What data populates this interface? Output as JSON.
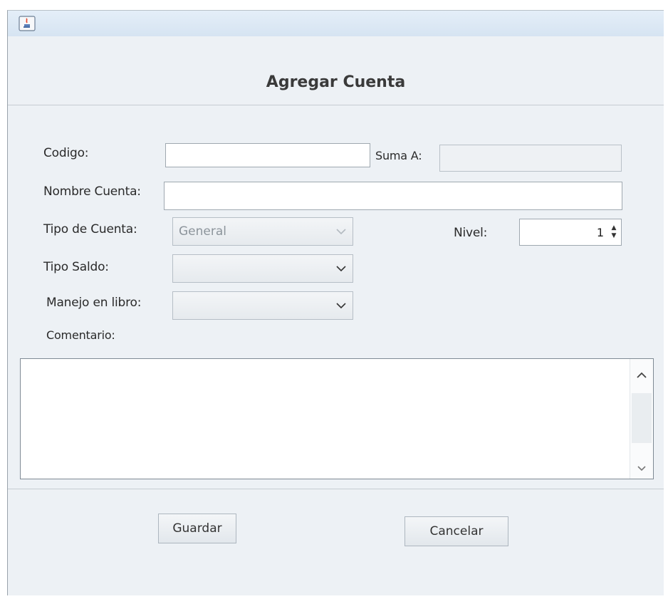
{
  "window": {
    "title": ""
  },
  "dialog": {
    "title": "Agregar Cuenta"
  },
  "form": {
    "codigo": {
      "label": "Codigo:",
      "value": ""
    },
    "suma_a": {
      "label": "Suma A:",
      "value": ""
    },
    "nombre_cuenta": {
      "label": "Nombre Cuenta:",
      "value": ""
    },
    "tipo_cuenta": {
      "label": "Tipo de Cuenta:",
      "selected": "General",
      "enabled": false
    },
    "nivel": {
      "label": "Nivel:",
      "value": "1"
    },
    "tipo_saldo": {
      "label": "Tipo Saldo:",
      "selected": ""
    },
    "manejo_libro": {
      "label": "Manejo en libro:",
      "selected": ""
    },
    "comentario": {
      "label": "Comentario:",
      "value": ""
    }
  },
  "buttons": {
    "save": "Guardar",
    "cancel": "Cancelar"
  },
  "icons": {
    "app": "java-cup-icon",
    "dropdown": "chevron-down-icon",
    "spin_up": "triangle-up-icon",
    "spin_down": "triangle-down-icon",
    "scroll_up": "chevron-up-icon",
    "scroll_down": "chevron-down-icon"
  },
  "colors": {
    "window_bg": "#edf1f5",
    "title_text": "#3a3a3a"
  }
}
